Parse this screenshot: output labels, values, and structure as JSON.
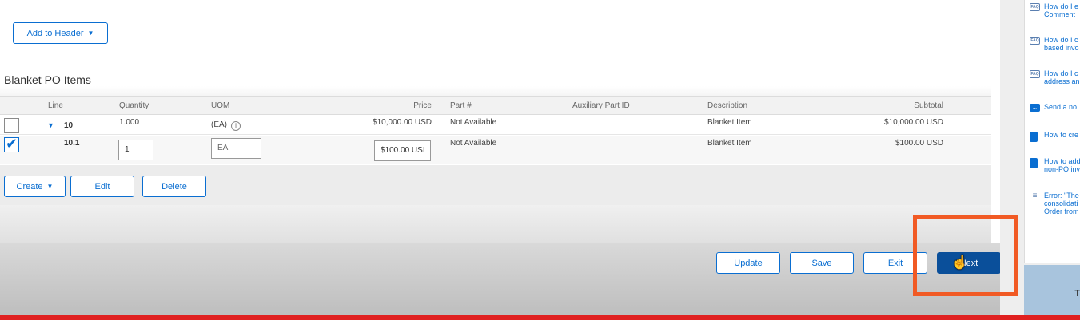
{
  "header": {
    "add_to_header_label": "Add to Header"
  },
  "section": {
    "title": "Blanket PO Items"
  },
  "table": {
    "columns": {
      "line": "Line",
      "quantity": "Quantity",
      "uom": "UOM",
      "price": "Price",
      "part": "Part #",
      "aux_part": "Auxiliary Part ID",
      "description": "Description",
      "subtotal": "Subtotal"
    },
    "rows": [
      {
        "checked": false,
        "line": "10",
        "quantity": "1.000",
        "uom": "(EA)",
        "price": "$10,000.00 USD",
        "part": "Not Available",
        "description": "Blanket Item",
        "subtotal": "$10,000.00 USD"
      },
      {
        "checked": true,
        "line": "10.1",
        "quantity": "1",
        "uom": "EA",
        "price": "$100.00 USI",
        "part": "Not Available",
        "description": "Blanket Item",
        "subtotal": "$100.00 USD"
      }
    ]
  },
  "actions": {
    "create_label": "Create",
    "edit_label": "Edit",
    "delete_label": "Delete"
  },
  "footer": {
    "update_label": "Update",
    "save_label": "Save",
    "exit_label": "Exit",
    "next_label": "Next"
  },
  "sidebar": {
    "items": [
      {
        "icon": "faq-icon",
        "text": "How do I e\nComment"
      },
      {
        "icon": "faq-icon",
        "text": "How do I c\nbased invo"
      },
      {
        "icon": "faq-icon",
        "text": "How do I c\naddress an"
      },
      {
        "icon": "chat-icon",
        "text": "Send a no"
      },
      {
        "icon": "document-icon",
        "text": "How to cre"
      },
      {
        "icon": "document-icon",
        "text": "How to add\nnon-PO inv"
      },
      {
        "icon": "article-icon",
        "text": "Error: \"The\nconsolidati\nOrder from"
      }
    ],
    "bottom_text": "T"
  },
  "colors": {
    "accent": "#0a6ed1",
    "primary_button": "#0a4f9a",
    "highlight_box": "#f15a24",
    "bottom_bar": "#e02020"
  }
}
